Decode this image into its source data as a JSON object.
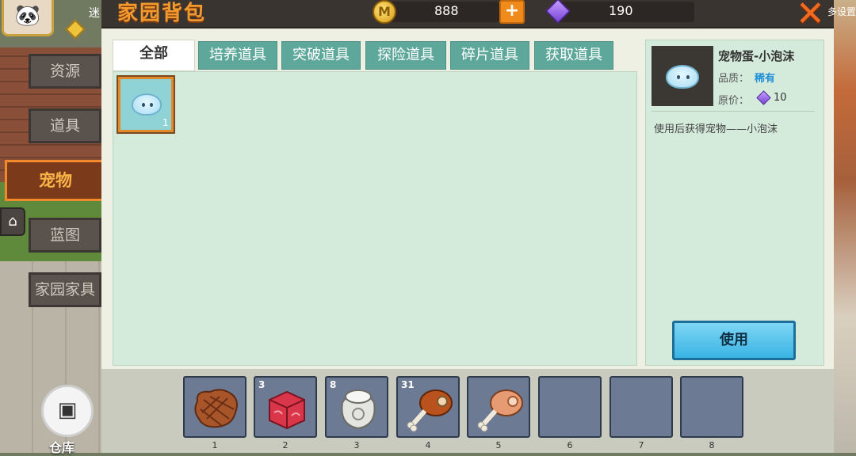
{
  "header": {
    "title": "家园背包",
    "coins": "888",
    "gems": "190",
    "hint_text": "多设置"
  },
  "player": {
    "mini_name": "迷"
  },
  "left_tabs": [
    {
      "label": "资源"
    },
    {
      "label": "道具"
    },
    {
      "label": "宠物"
    },
    {
      "label": "蓝图"
    },
    {
      "label": "家园家具"
    }
  ],
  "category_tabs": [
    {
      "label": "全部"
    },
    {
      "label": "培养道具"
    },
    {
      "label": "突破道具"
    },
    {
      "label": "探险道具"
    },
    {
      "label": "碎片道具"
    },
    {
      "label": "获取道具"
    }
  ],
  "inventory": {
    "selected_slot_count": "1"
  },
  "detail": {
    "name": "宠物蛋-小泡沫",
    "quality_label": "品质：",
    "quality_value": "稀有",
    "price_label": "原价：",
    "price_value": "10",
    "description": "使用后获得宠物——小泡沫",
    "use_button": "使用"
  },
  "hotbar": {
    "slots": [
      {
        "number": "1",
        "count": "",
        "item": "steak-icon"
      },
      {
        "number": "2",
        "count": "3",
        "item": "raw-meat-icon"
      },
      {
        "number": "3",
        "count": "8",
        "item": "flour-sack-icon"
      },
      {
        "number": "4",
        "count": "31",
        "item": "roast-leg-icon"
      },
      {
        "number": "5",
        "count": "",
        "item": "ham-leg-icon"
      },
      {
        "number": "6",
        "count": "",
        "item": ""
      },
      {
        "number": "7",
        "count": "",
        "item": ""
      },
      {
        "number": "8",
        "count": "",
        "item": ""
      }
    ]
  },
  "warehouse_label": "仓库"
}
